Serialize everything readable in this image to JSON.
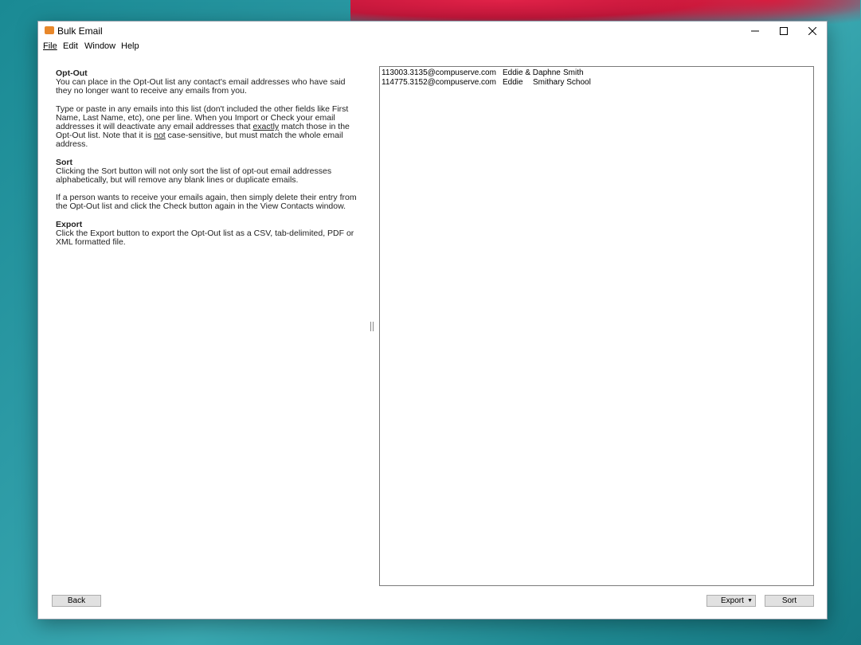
{
  "window": {
    "title": "Bulk Email",
    "accent_color": "#e8872a"
  },
  "menu": {
    "file": "File",
    "edit": "Edit",
    "window": "Window",
    "help": "Help"
  },
  "help": {
    "optout_heading": "Opt-Out",
    "optout_p1": "You can place in the Opt-Out list any contact's email addresses who have said they no longer want to receive any emails from you.",
    "optout_p2_a": "Type or paste in any emails into this list (don't included the other fields like First Name, Last Name, etc), one per line. When you Import or Check your email addresses it will deactivate any email addresses that ",
    "optout_p2_exactly": "exactly",
    "optout_p2_b": " match those in the Opt-Out list. Note that it is ",
    "optout_p2_not": "not",
    "optout_p2_c": " case-sensitive, but must match the whole email address.",
    "sort_heading": "Sort",
    "sort_p1": "Clicking the Sort button will not only sort the list of opt-out email addresses alphabetically, but will remove any blank lines or duplicate emails.",
    "sort_p2": "If a person wants to receive your emails again, then simply delete their entry from the Opt-Out list and click the Check button again in the View Contacts window.",
    "export_heading": "Export",
    "export_p1": "Click the Export button to export the Opt-Out list as a CSV, tab-delimited, PDF or XML formatted file."
  },
  "optout_list": [
    {
      "email": "113003.3135@compuserve.com",
      "first": "Eddie & Daphne",
      "last": "Smith"
    },
    {
      "email": "114775.3152@compuserve.com",
      "first": "Eddie",
      "last": "Smithary School"
    }
  ],
  "buttons": {
    "back": "Back",
    "export": "Export",
    "sort": "Sort"
  }
}
